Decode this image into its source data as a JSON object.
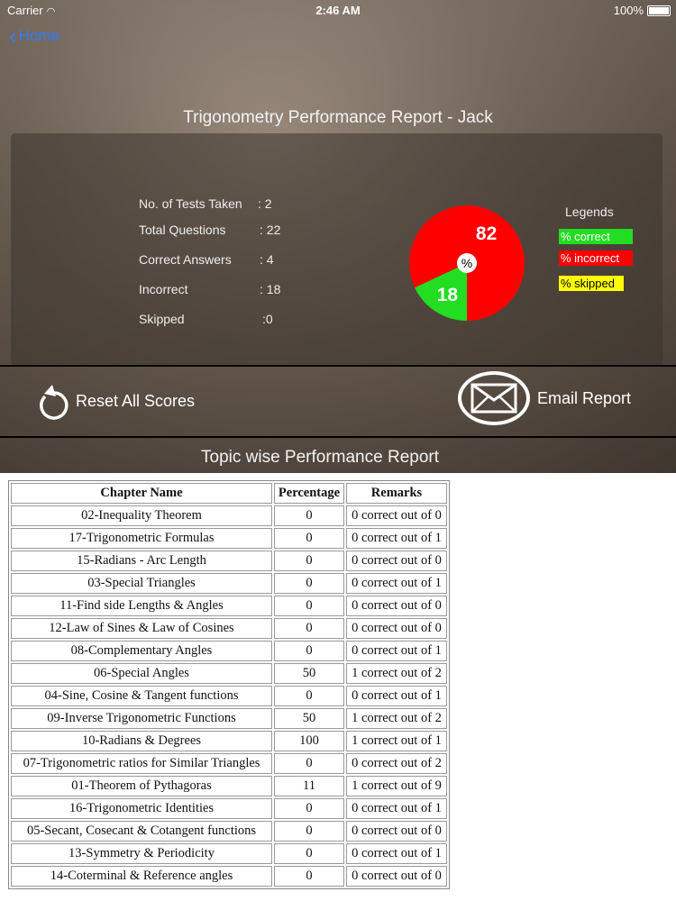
{
  "status": {
    "carrier": "Carrier",
    "time": "2:46 AM",
    "battery": "100%"
  },
  "nav": {
    "back_label": "Home"
  },
  "report_title": "Trigonometry Performance  Report - Jack",
  "stats": [
    {
      "label": "No. of Tests Taken",
      "value": "2"
    },
    {
      "label": "Total Questions",
      "value": "22"
    },
    {
      "label": "Correct Answers",
      "value": "4"
    },
    {
      "label": "Incorrect",
      "value": "18"
    },
    {
      "label": "Skipped",
      "value": "0"
    }
  ],
  "chart_data": {
    "type": "pie",
    "center_label": "%",
    "slices": [
      {
        "name": "% correct",
        "value": 18,
        "color": "#22dd22"
      },
      {
        "name": "% incorrect",
        "value": 82,
        "color": "#ff0000"
      },
      {
        "name": "% skipped",
        "value": 0,
        "color": "#ffff00"
      }
    ],
    "legend": {
      "title": "Legends",
      "placement": "right"
    }
  },
  "actions": {
    "reset_label": "Reset All Scores",
    "email_label": "Email Report"
  },
  "topic_title": "Topic wise Performance Report",
  "table": {
    "headers": [
      "Chapter Name",
      "Percentage",
      "Remarks"
    ],
    "rows": [
      [
        "02-Inequality Theorem",
        "0",
        "0 correct out of 0"
      ],
      [
        "17-Trigonometric Formulas",
        "0",
        "0 correct out of 1"
      ],
      [
        "15-Radians - Arc Length",
        "0",
        "0 correct out of 0"
      ],
      [
        "03-Special Triangles",
        "0",
        "0 correct out of 1"
      ],
      [
        "11-Find side Lengths & Angles",
        "0",
        "0 correct out of 0"
      ],
      [
        "12-Law of Sines & Law of Cosines",
        "0",
        "0 correct out of 0"
      ],
      [
        "08-Complementary Angles",
        "0",
        "0 correct out of 1"
      ],
      [
        "06-Special Angles",
        "50",
        "1 correct out of 2"
      ],
      [
        "04-Sine, Cosine & Tangent functions",
        "0",
        "0 correct out of 1"
      ],
      [
        "09-Inverse Trigonometric Functions",
        "50",
        "1 correct out of 2"
      ],
      [
        "10-Radians & Degrees",
        "100",
        "1 correct out of 1"
      ],
      [
        "07-Trigonometric ratios for Similar Triangles",
        "0",
        "0 correct out of 2"
      ],
      [
        "01-Theorem of Pythagoras",
        "11",
        "1 correct out of 9"
      ],
      [
        "16-Trigonometric Identities",
        "0",
        "0 correct out of 1"
      ],
      [
        "05-Secant, Cosecant & Cotangent functions",
        "0",
        "0 correct out of 0"
      ],
      [
        "13-Symmetry & Periodicity",
        "0",
        "0 correct out of 1"
      ],
      [
        "14-Coterminal & Reference angles",
        "0",
        "0 correct out of 0"
      ]
    ]
  }
}
